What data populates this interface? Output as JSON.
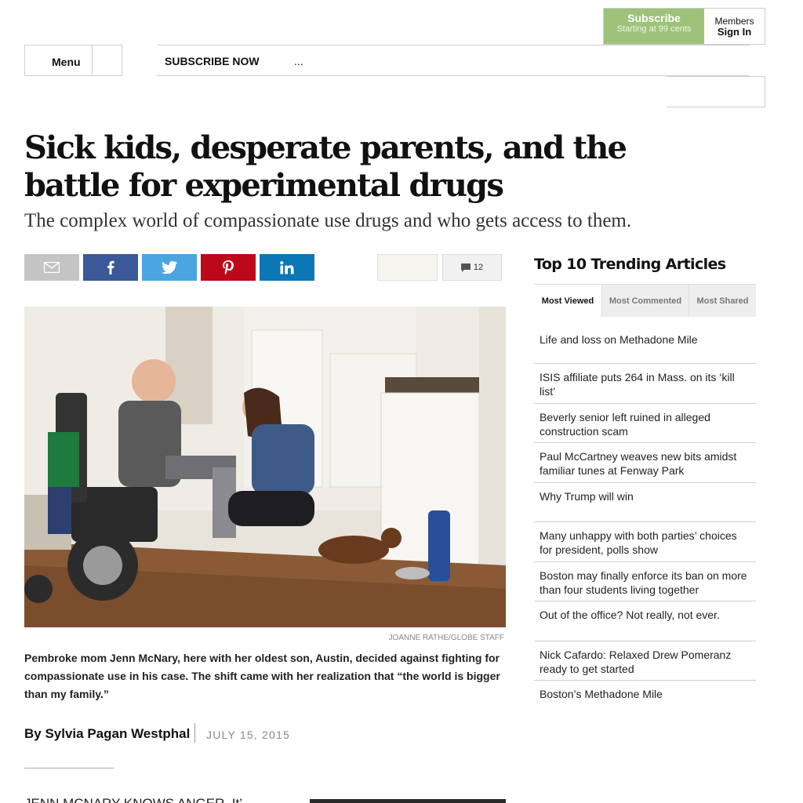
{
  "header": {
    "subscribe_title": "Subscribe",
    "subscribe_price": "Starting at 99 cents",
    "members_label": "Members",
    "signin_label": "Sign In",
    "menu_label": "Menu",
    "nav_subscribe": "SUBSCRIBE NOW",
    "nav_more": "..."
  },
  "article": {
    "headline": "Sick kids, desperate parents, and the battle for experimental drugs",
    "subhead": "The complex world of compassionate use drugs and who gets access to them.",
    "comment_count": "12",
    "photo_credit": "JOANNE RATHE/GLOBE STAFF",
    "caption": "Pembroke mom Jenn McNary, here with her oldest son, Austin, decided against fighting for compassionate use in his case. The shift came with her realization that “the world is bigger than my family.”",
    "byline": "By Sylvia Pagan Westphal",
    "date": "JULY 15, 2015",
    "body_start": "JENN MCNARY KNOWS ANGER. It’"
  },
  "share": {
    "icons": [
      "mail-icon",
      "facebook-icon",
      "twitter-icon",
      "pinterest-icon",
      "linkedin-icon"
    ],
    "colors": {
      "mail": "#c4c4c4",
      "facebook": "#3b5998",
      "twitter": "#4aa5e0",
      "pinterest": "#bd081c",
      "linkedin": "#0c77b5"
    }
  },
  "trending": {
    "title": "Top 10 Trending Articles",
    "tabs": [
      "Most Viewed",
      "Most Commented",
      "Most Shared"
    ],
    "items": [
      "Life and loss on Methadone Mile",
      "ISIS affiliate puts 264 in Mass. on its ‘kill list’",
      "Beverly senior left ruined in alleged construction scam",
      "Paul McCartney weaves new bits amidst familiar tunes at Fenway Park",
      "Why Trump will win",
      "Many unhappy with both parties’ choices for president, polls show",
      "Boston may finally enforce its ban on more than four students living together",
      "Out of the office? Not really, not ever.",
      "Nick Cafardo: Relaxed Drew Pomeranz ready to get started",
      "Boston’s Methadone Mile"
    ]
  },
  "colors": {
    "subscribe_green": "#9dc37a"
  }
}
